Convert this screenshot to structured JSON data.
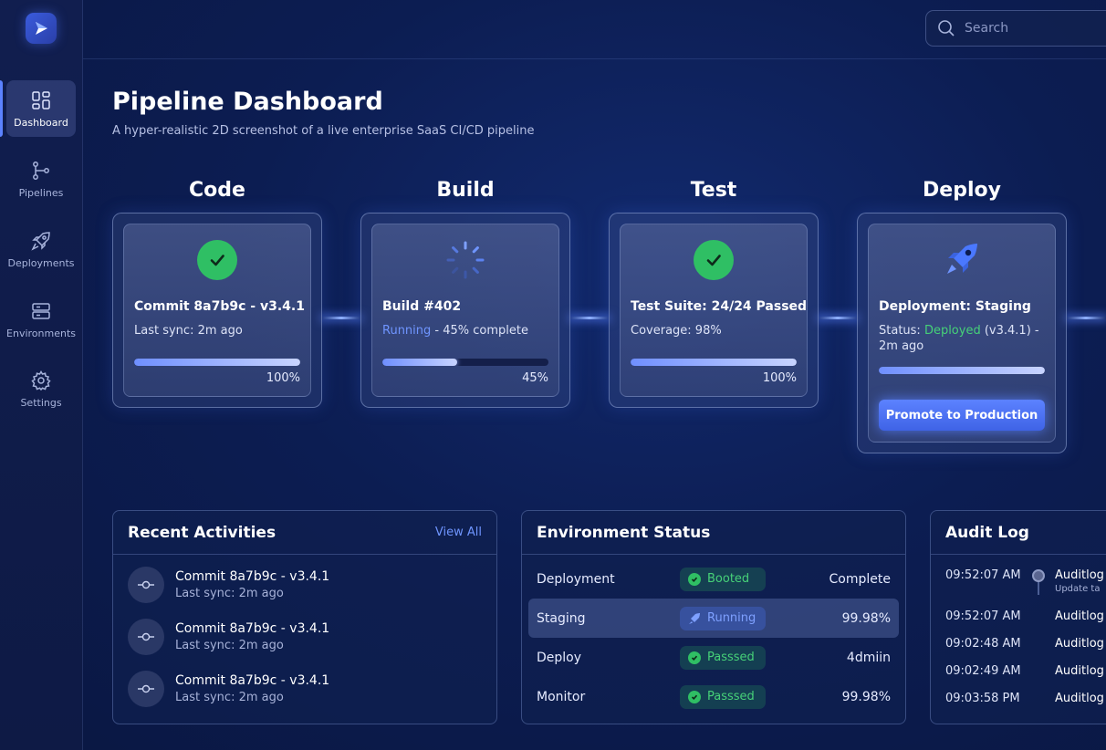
{
  "sidebar": {
    "items": [
      {
        "label": "Dashboard",
        "icon": "dashboard-icon",
        "active": true
      },
      {
        "label": "Pipelines",
        "icon": "git-branch-icon"
      },
      {
        "label": "Deployments",
        "icon": "rocket-icon"
      },
      {
        "label": "Environments",
        "icon": "server-icon"
      },
      {
        "label": "Settings",
        "icon": "gear-icon"
      }
    ]
  },
  "search": {
    "placeholder": "Search"
  },
  "header": {
    "title": "Pipeline Dashboard",
    "subtitle": "A hyper-realistic 2D screenshot of a live enterprise SaaS CI/CD pipeline"
  },
  "stages": [
    {
      "name": "Code",
      "title": "Commit 8a7b9c - v3.4.1",
      "sub": "Last sync: 2m ago",
      "progress": 100,
      "pct_label": "100%",
      "status": "success"
    },
    {
      "name": "Build",
      "title": "Build #402",
      "status_word": "Running",
      "sub_rest": " - 45% complete",
      "progress": 45,
      "pct_label": "45%",
      "status": "running"
    },
    {
      "name": "Test",
      "title": "Test Suite: 24/24 Passed",
      "sub": "Coverage: 98%",
      "progress": 100,
      "pct_label": "100%",
      "status": "success"
    },
    {
      "name": "Deploy",
      "title": "Deployment: Staging",
      "sub_prefix": "Status: ",
      "status_word": "Deployed",
      "sub_rest": " (v3.4.1) - 2m ago",
      "progress": 100,
      "button": "Promote to Production",
      "status": "deployed"
    }
  ],
  "activities": {
    "title": "Recent Activities",
    "view_all": "View All",
    "items": [
      {
        "title": "Commit 8a7b9c - v3.4.1",
        "sub": "Last sync: 2m ago"
      },
      {
        "title": "Commit 8a7b9c - v3.4.1",
        "sub": "Last sync: 2m ago"
      },
      {
        "title": "Commit 8a7b9c - v3.4.1",
        "sub": "Last sync: 2m ago"
      }
    ]
  },
  "environments": {
    "title": "Environment Status",
    "rows": [
      {
        "name": "Deployment",
        "badge": "Booted",
        "badge_type": "ok",
        "value": "Complete"
      },
      {
        "name": "Staging",
        "badge": "Running",
        "badge_type": "run",
        "value": "99.98%"
      },
      {
        "name": "Deploy",
        "badge": "Passsed",
        "badge_type": "ok",
        "value": "4dmiin"
      },
      {
        "name": "Monitor",
        "badge": "Passsed",
        "badge_type": "ok",
        "value": "99.98%"
      }
    ]
  },
  "audit": {
    "title": "Audit Log",
    "rows": [
      {
        "time": "09:52:07 AM",
        "label": "Auditlog",
        "sub": "Update ta"
      },
      {
        "time": "09:52:07 AM",
        "label": "Auditlog"
      },
      {
        "time": "09:02:48 AM",
        "label": "Auditlog"
      },
      {
        "time": "09:02:49 AM",
        "label": "Auditlog"
      },
      {
        "time": "09:03:58 PM",
        "label": "Auditlog"
      }
    ]
  }
}
